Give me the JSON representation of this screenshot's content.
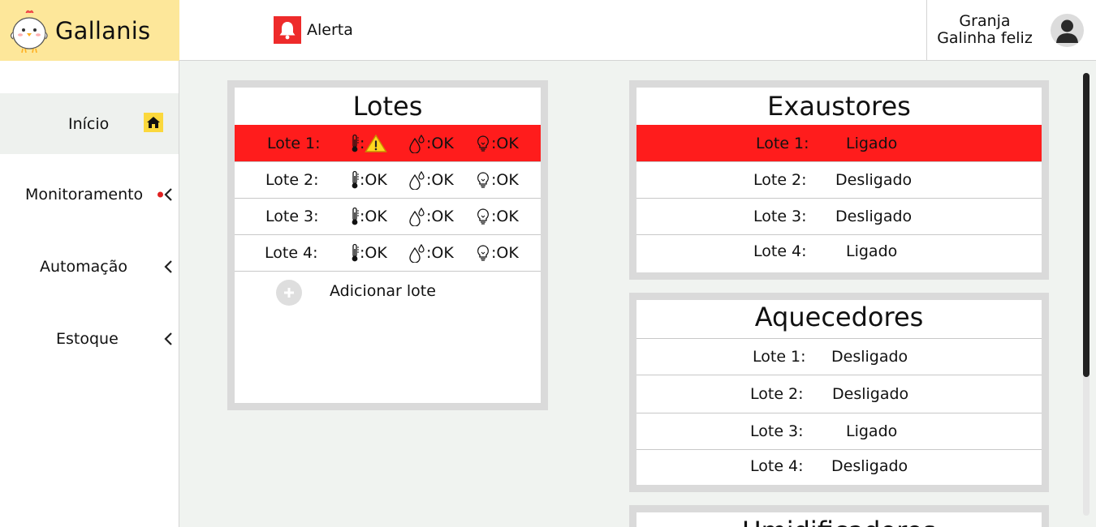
{
  "app": {
    "name": "Gallanis"
  },
  "header": {
    "alert_label": "Alerta",
    "user_line1": "Granja",
    "user_line2": "Galinha feliz"
  },
  "sidebar": {
    "items": [
      {
        "label": "Início",
        "icon": "home-icon"
      },
      {
        "label": "Monitoramento",
        "icon": "chevron-left-icon",
        "notification": true
      },
      {
        "label": "Automação",
        "icon": "chevron-left-icon"
      },
      {
        "label": "Estoque",
        "icon": "chevron-left-icon"
      }
    ]
  },
  "lotes": {
    "title": "Lotes",
    "rows": [
      {
        "name": "Lote 1:",
        "temp": "",
        "temp_alert": true,
        "humidity": ":OK",
        "light": ":OK",
        "alert": true
      },
      {
        "name": "Lote 2:",
        "temp": ":OK",
        "humidity": ":OK",
        "light": ":OK",
        "alert": false
      },
      {
        "name": "Lote 3:",
        "temp": ":OK",
        "humidity": ":OK",
        "light": ":OK",
        "alert": false
      },
      {
        "name": "Lote 4:",
        "temp": ":OK",
        "humidity": ":OK",
        "light": ":OK",
        "alert": false
      }
    ],
    "add_label": "Adicionar lote"
  },
  "exaustores": {
    "title": "Exaustores",
    "rows": [
      {
        "name": "Lote 1:",
        "status": "Ligado",
        "alert": true
      },
      {
        "name": "Lote 2:",
        "status": "Desligado"
      },
      {
        "name": "Lote 3:",
        "status": "Desligado"
      },
      {
        "name": "Lote 4:",
        "status": "Ligado"
      }
    ]
  },
  "aquecedores": {
    "title": "Aquecedores",
    "rows": [
      {
        "name": "Lote 1:",
        "status": "Desligado"
      },
      {
        "name": "Lote 2:",
        "status": "Desligado"
      },
      {
        "name": "Lote 3:",
        "status": "Ligado"
      },
      {
        "name": "Lote 4:",
        "status": "Desligado"
      }
    ]
  },
  "umidificadores": {
    "title": "Umidificadores"
  },
  "colors": {
    "alert_red": "#ff1c1c",
    "brand_yellow": "#fde79a",
    "accent_yellow": "#fbd83c"
  }
}
